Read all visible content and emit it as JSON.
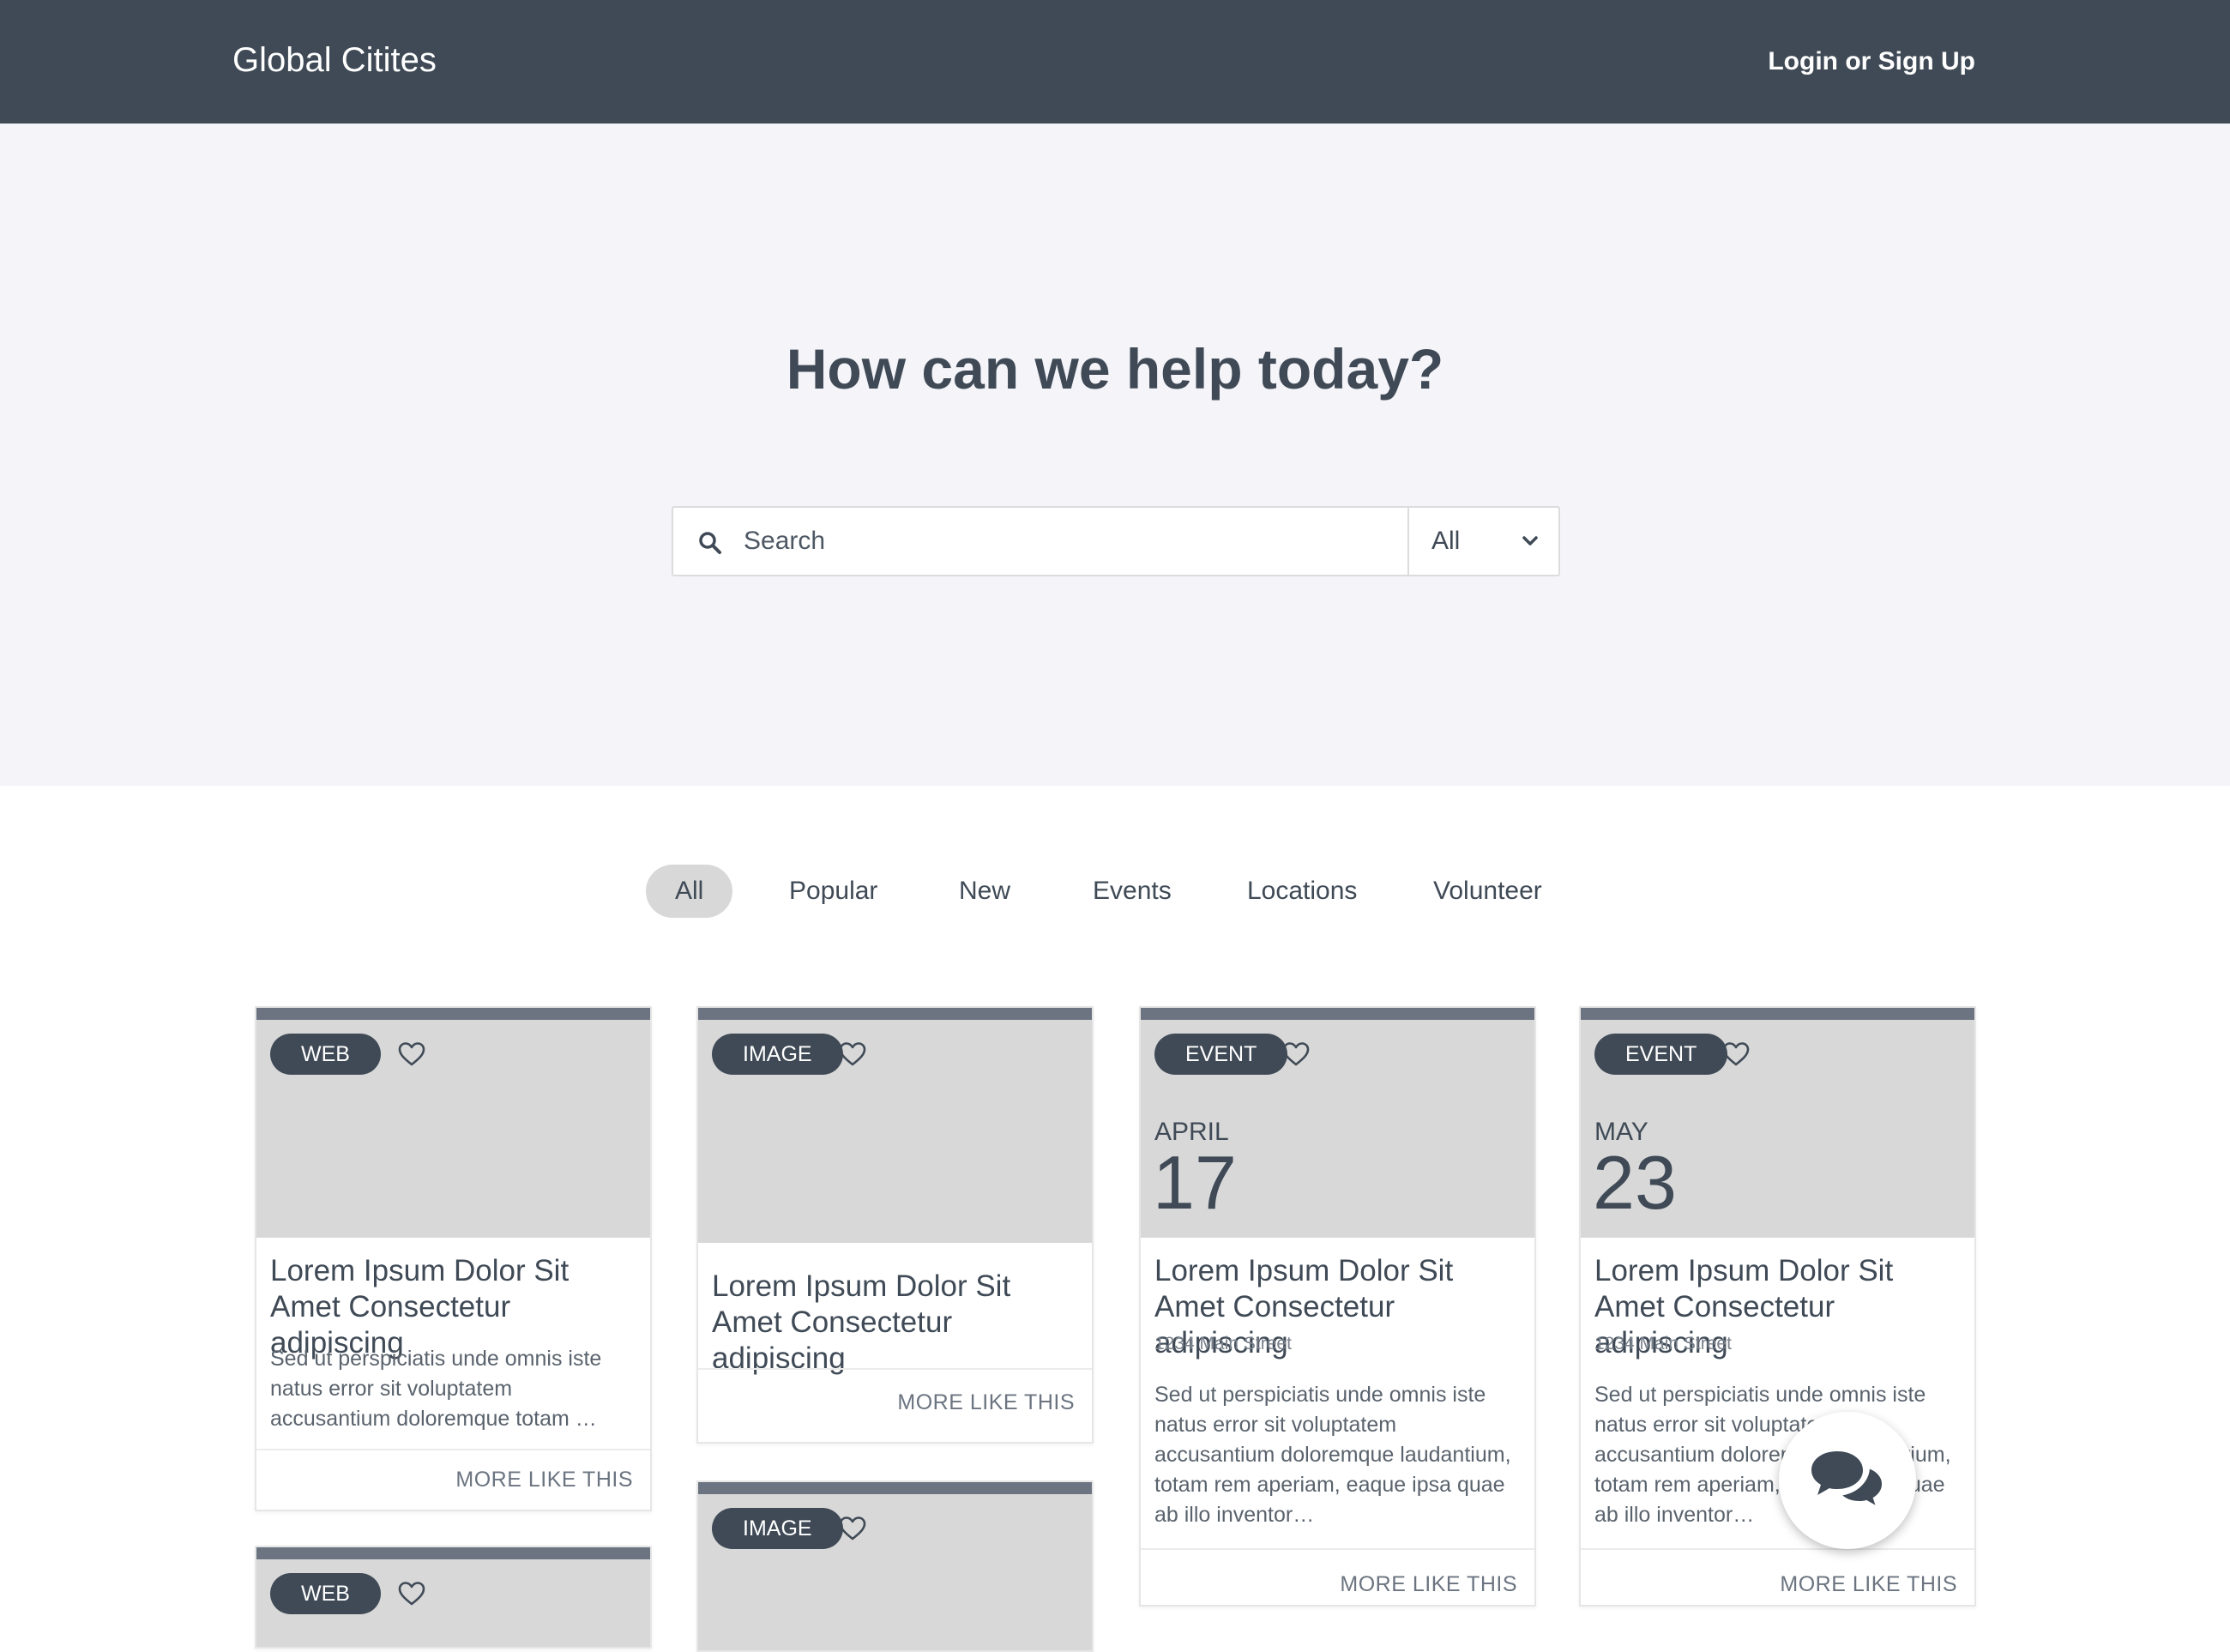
{
  "header": {
    "brand": "Global Citites",
    "login": "Login or Sign Up"
  },
  "hero": {
    "title": "How can we help today?",
    "search_placeholder": "Search",
    "filter_value": "All"
  },
  "tabs": [
    {
      "label": "All",
      "active": true
    },
    {
      "label": "Popular"
    },
    {
      "label": "New"
    },
    {
      "label": "Events"
    },
    {
      "label": "Locations"
    },
    {
      "label": "Volunteer"
    }
  ],
  "cards": [
    {
      "badge": "WEB",
      "title": "Lorem Ipsum Dolor Sit Amet Consectetur adipiscing",
      "text": "Sed ut perspiciatis unde omnis iste natus error sit voluptatem accusantium doloremque totam …",
      "more": "MORE LIKE THIS"
    },
    {
      "badge": "IMAGE",
      "title": "Lorem Ipsum Dolor Sit Amet Consectetur adipiscing",
      "more": "MORE LIKE THIS"
    },
    {
      "badge": "EVENT",
      "month": "APRIL",
      "day": "17",
      "title": "Lorem Ipsum Dolor Sit Amet Consectetur adipiscing",
      "address": "1234 Main Street",
      "text": "Sed ut perspiciatis unde omnis iste natus error sit voluptatem accusantium doloremque laudantium, totam rem aperiam, eaque ipsa quae ab illo inventor…",
      "more": "MORE LIKE THIS"
    },
    {
      "badge": "EVENT",
      "month": "MAY",
      "day": "23",
      "title": "Lorem Ipsum Dolor Sit Amet Consectetur adipiscing",
      "address": "1234 Main Street",
      "text": "Sed ut perspiciatis unde omnis iste natus error sit voluptatem accusantium doloremque laudantium, totam rem aperiam, eaque ipsa quae ab illo inventor…",
      "more": "MORE LIKE THIS"
    },
    {
      "badge": "IMAGE"
    },
    {
      "badge": "WEB"
    }
  ],
  "colors": {
    "header_bg": "#3f4a56",
    "hero_bg": "#f4f4f9",
    "placeholder_bg": "#d8d8d8",
    "badge_bg": "#3f4a56",
    "accent_bar": "#6b7480"
  },
  "icons": {
    "search": "search-icon",
    "chevron": "chevron-down-icon",
    "heart": "heart-outline-icon",
    "chat": "chat-bubbles-icon"
  }
}
